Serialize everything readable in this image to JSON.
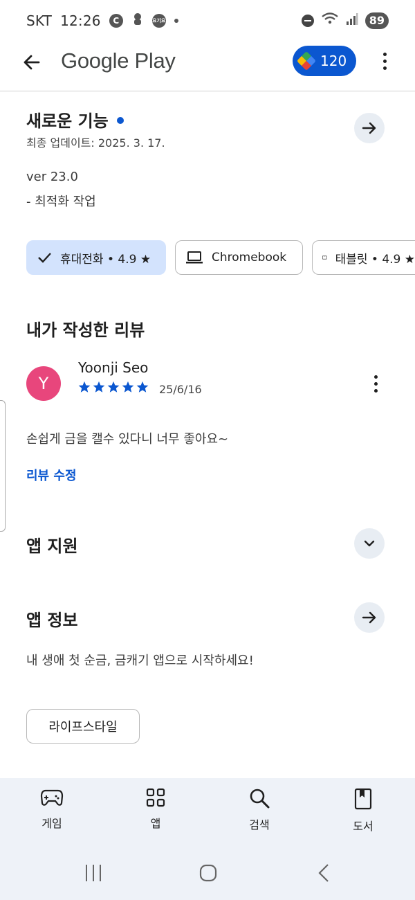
{
  "status_bar": {
    "carrier": "SKT",
    "time": "12:26",
    "badge_c": "C",
    "badge_app": "요기요",
    "battery": "89"
  },
  "app_bar": {
    "brand": "Google Play",
    "points": "120"
  },
  "whats_new": {
    "title": "새로운 기능",
    "updated": "최종 업데이트: 2025. 3. 17.",
    "version": "ver 23.0",
    "note": "- 최적화 작업"
  },
  "device_chips": [
    {
      "label": "휴대전화 • 4.9 ★",
      "selected": true
    },
    {
      "label": "Chromebook",
      "selected": false
    },
    {
      "label": "태블릿 • 4.9 ★",
      "selected": false
    }
  ],
  "my_review": {
    "heading": "내가 작성한 리뷰",
    "avatar_letter": "Y",
    "author": "Yoonji Seo",
    "rating": 5,
    "rating_max": 5,
    "date": "25/6/16",
    "text": "손쉽게 금을 캘수 있다니 너무 좋아요~",
    "edit_link": "리뷰 수정"
  },
  "app_support": {
    "heading": "앱 지원"
  },
  "app_info": {
    "heading": "앱 정보",
    "description": "내 생애 첫 순금, 금캐기 앱으로 시작하세요!",
    "category_tag": "라이프스타일"
  },
  "bottom_nav": {
    "games": "게임",
    "apps": "앱",
    "search": "검색",
    "books": "도서"
  },
  "colors": {
    "accent": "#0b57d0",
    "chip_selected": "#d3e3fd",
    "avatar": "#e8467c",
    "nav_bg": "#eef2f8"
  }
}
